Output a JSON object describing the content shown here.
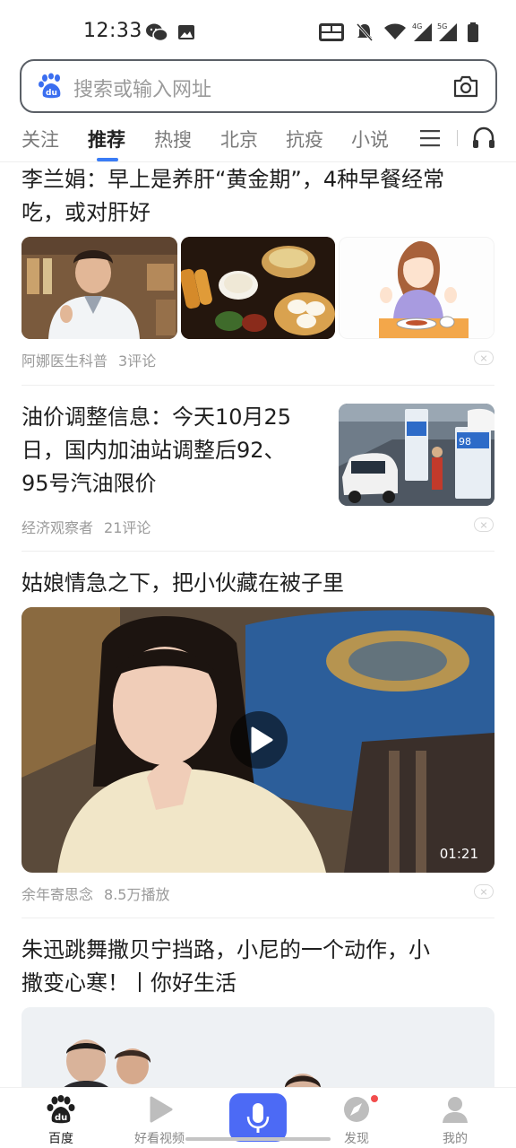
{
  "status_bar": {
    "time": "12:33"
  },
  "search": {
    "placeholder": "搜索或输入网址"
  },
  "tabs": [
    {
      "label": "关注"
    },
    {
      "label": "推荐"
    },
    {
      "label": "热搜"
    },
    {
      "label": "北京"
    },
    {
      "label": "抗疫"
    },
    {
      "label": "小说"
    }
  ],
  "feed": [
    {
      "title": "李兰娟：早上是养肝“黄金期”，4种早餐经常吃，或对肝好",
      "title_lines": [
        "李兰娟：早上是养肝“黄金期”，4种早餐经常",
        "吃，或对肝好"
      ],
      "source": "阿娜医生科普",
      "stat": "3评论"
    },
    {
      "title_lines": [
        "油价调整信息：今天10月25",
        "日，国内加油站调整后92、",
        "95号汽油限价"
      ],
      "source": "经济观察者",
      "stat": "21评论"
    },
    {
      "title_lines": [
        "姑娘情急之下，把小伙藏在被子里"
      ],
      "source": "余年寄思念",
      "stat": "8.5万播放",
      "duration": "01:21"
    },
    {
      "title_lines": [
        "朱迅跳舞撒贝宁挡路，小尼的一个动作，小",
        "撒变心寒！丨你好生活"
      ]
    }
  ],
  "bottom_nav": [
    {
      "label": "百度"
    },
    {
      "label": "好看视频"
    },
    {
      "label": "发现"
    },
    {
      "label": "我的"
    }
  ],
  "colors": {
    "accent": "#3a7cf6",
    "mic": "#4c6af5",
    "badge": "#f24d4d"
  }
}
